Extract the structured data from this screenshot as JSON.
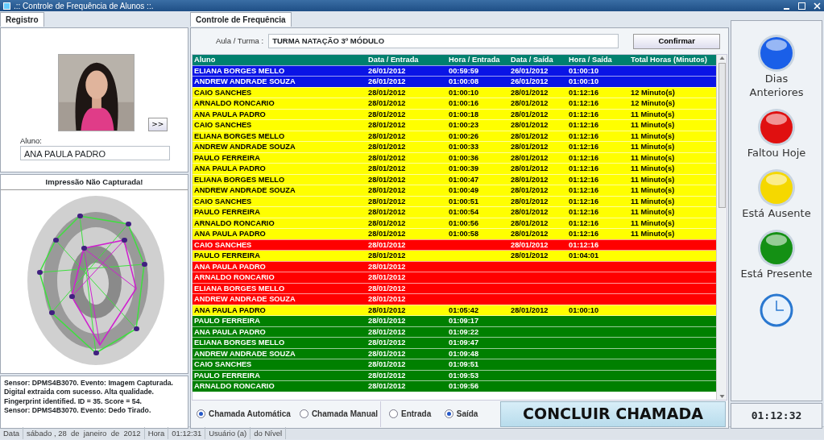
{
  "window": {
    "title": ".:: Controle de Frequência de Alunos ::."
  },
  "left_panel": {
    "tab": {
      "label": "Registro",
      "selected": true
    },
    "next_button": ">>",
    "student_label": "Aluno:",
    "student_value": "ANA PAULA PADRO",
    "fingerprint_status": "Impressão Não Capturada!",
    "log": [
      "Sensor: DPMS4B3070. Evento: Imagem Capturada.",
      "Digital extraida com sucesso. Alta qualidade.",
      "Fingerprint identified. ID = 35. Score = 54.",
      "Sensor: DPMS4B3070. Evento: Dedo Tirado."
    ]
  },
  "main": {
    "tab": {
      "label": "Controle de Frequência",
      "selected": true
    },
    "class_label": "Aula / Turma :",
    "class_value": "TURMA NATAÇÃO 3º MÓDULO",
    "confirm_button": "Confirmar",
    "table": {
      "columns": [
        "Aluno",
        "Data / Entrada",
        "Hora / Entrada",
        "Data / Saída",
        "Hora / Saída",
        "Total Horas (Minutos)"
      ],
      "rows": [
        {
          "kind": "previous",
          "student": "ELIANA BORGES MELLO",
          "date_in": "26/01/2012",
          "time_in": "00:59:59",
          "date_out": "26/01/2012",
          "time_out": "01:00:10"
        },
        {
          "kind": "previous",
          "student": "ANDREW ANDRADE SOUZA",
          "date_in": "26/01/2012",
          "time_in": "01:00:08",
          "date_out": "26/01/2012",
          "time_out": "01:00:10"
        },
        {
          "kind": "absent",
          "student": "CAIO SANCHES",
          "date_in": "28/01/2012",
          "time_in": "01:00:10",
          "date_out": "28/01/2012",
          "time_out": "01:12:16",
          "total": "12 Minuto(s)"
        },
        {
          "kind": "absent",
          "student": "ARNALDO RONCARIO",
          "date_in": "28/01/2012",
          "time_in": "01:00:16",
          "date_out": "28/01/2012",
          "time_out": "01:12:16",
          "total": "12 Minuto(s)"
        },
        {
          "kind": "absent",
          "student": "ANA PAULA PADRO",
          "date_in": "28/01/2012",
          "time_in": "01:00:18",
          "date_out": "28/01/2012",
          "time_out": "01:12:16",
          "total": "11 Minuto(s)"
        },
        {
          "kind": "absent",
          "student": "CAIO SANCHES",
          "date_in": "28/01/2012",
          "time_in": "01:00:23",
          "date_out": "28/01/2012",
          "time_out": "01:12:16",
          "total": "11 Minuto(s)"
        },
        {
          "kind": "absent",
          "student": "ELIANA BORGES MELLO",
          "date_in": "28/01/2012",
          "time_in": "01:00:26",
          "date_out": "28/01/2012",
          "time_out": "01:12:16",
          "total": "11 Minuto(s)"
        },
        {
          "kind": "absent",
          "student": "ANDREW ANDRADE SOUZA",
          "date_in": "28/01/2012",
          "time_in": "01:00:33",
          "date_out": "28/01/2012",
          "time_out": "01:12:16",
          "total": "11 Minuto(s)"
        },
        {
          "kind": "absent",
          "student": "PAULO FERREIRA",
          "date_in": "28/01/2012",
          "time_in": "01:00:36",
          "date_out": "28/01/2012",
          "time_out": "01:12:16",
          "total": "11 Minuto(s)"
        },
        {
          "kind": "absent",
          "student": "ANA PAULA PADRO",
          "date_in": "28/01/2012",
          "time_in": "01:00:39",
          "date_out": "28/01/2012",
          "time_out": "01:12:16",
          "total": "11 Minuto(s)"
        },
        {
          "kind": "absent",
          "student": "ELIANA BORGES MELLO",
          "date_in": "28/01/2012",
          "time_in": "01:00:47",
          "date_out": "28/01/2012",
          "time_out": "01:12:16",
          "total": "11 Minuto(s)"
        },
        {
          "kind": "absent",
          "student": "ANDREW ANDRADE SOUZA",
          "date_in": "28/01/2012",
          "time_in": "01:00:49",
          "date_out": "28/01/2012",
          "time_out": "01:12:16",
          "total": "11 Minuto(s)"
        },
        {
          "kind": "absent",
          "student": "CAIO SANCHES",
          "date_in": "28/01/2012",
          "time_in": "01:00:51",
          "date_out": "28/01/2012",
          "time_out": "01:12:16",
          "total": "11 Minuto(s)"
        },
        {
          "kind": "absent",
          "student": "PAULO FERREIRA",
          "date_in": "28/01/2012",
          "time_in": "01:00:54",
          "date_out": "28/01/2012",
          "time_out": "01:12:16",
          "total": "11 Minuto(s)"
        },
        {
          "kind": "absent",
          "student": "ARNALDO RONCARIO",
          "date_in": "28/01/2012",
          "time_in": "01:00:56",
          "date_out": "28/01/2012",
          "time_out": "01:12:16",
          "total": "11 Minuto(s)"
        },
        {
          "kind": "absent",
          "student": "ANA PAULA PADRO",
          "date_in": "28/01/2012",
          "time_in": "01:00:58",
          "date_out": "28/01/2012",
          "time_out": "01:12:16",
          "total": "11 Minuto(s)"
        },
        {
          "kind": "missed",
          "student": "CAIO SANCHES",
          "date_in": "28/01/2012",
          "date_out": "28/01/2012",
          "time_out": "01:12:16"
        },
        {
          "kind": "absent",
          "student": "PAULO FERREIRA",
          "date_in": "28/01/2012",
          "date_out": "28/01/2012",
          "time_out": "01:04:01"
        },
        {
          "kind": "missed",
          "student": "ANA PAULA PADRO",
          "date_in": "28/01/2012"
        },
        {
          "kind": "missed",
          "student": "ARNALDO RONCARIO",
          "date_in": "28/01/2012"
        },
        {
          "kind": "missed",
          "student": "ELIANA BORGES MELLO",
          "date_in": "28/01/2012"
        },
        {
          "kind": "missed",
          "student": "ANDREW ANDRADE SOUZA",
          "date_in": "28/01/2012"
        },
        {
          "kind": "absent",
          "student": "ANA PAULA PADRO",
          "date_in": "28/01/2012",
          "time_in": "01:05:42",
          "date_out": "28/01/2012",
          "time_out": "01:00:10"
        },
        {
          "kind": "present",
          "student": "PAULO FERREIRA",
          "date_in": "28/01/2012",
          "time_in": "01:09:17"
        },
        {
          "kind": "present",
          "student": "ANA PAULA PADRO",
          "date_in": "28/01/2012",
          "time_in": "01:09:22"
        },
        {
          "kind": "present",
          "student": "ELIANA BORGES MELLO",
          "date_in": "28/01/2012",
          "time_in": "01:09:47"
        },
        {
          "kind": "present",
          "student": "ANDREW ANDRADE SOUZA",
          "date_in": "28/01/2012",
          "time_in": "01:09:48"
        },
        {
          "kind": "present",
          "student": "CAIO SANCHES",
          "date_in": "28/01/2012",
          "time_in": "01:09:51"
        },
        {
          "kind": "present",
          "student": "PAULO FERREIRA",
          "date_in": "28/01/2012",
          "time_in": "01:09:53"
        },
        {
          "kind": "present",
          "student": "ARNALDO RONCARIO",
          "date_in": "28/01/2012",
          "time_in": "01:09:56"
        }
      ]
    },
    "call_modes": [
      {
        "label": "Chamada Automática",
        "selected": true
      },
      {
        "label": "Chamada Manual",
        "selected": false
      }
    ],
    "directions": [
      {
        "label": "Entrada",
        "selected": false
      },
      {
        "label": "Saída",
        "selected": true
      }
    ],
    "finish_button": "CONCLUIR CHAMADA"
  },
  "legend": [
    {
      "label": "Dias Anteriores",
      "color": "#1a5fe8"
    },
    {
      "label": "Faltou Hoje",
      "color": "#e01010"
    },
    {
      "label": "Está Ausente",
      "color": "#f5d800"
    },
    {
      "label": "Está Presente",
      "color": "#149014"
    }
  ],
  "clock": "01:12:32",
  "status_bar": [
    "Data",
    "sábado , 28  de  janeiro  de  2012",
    "Hora",
    "01:12:31",
    "Usuário (a)",
    "do Nível"
  ]
}
